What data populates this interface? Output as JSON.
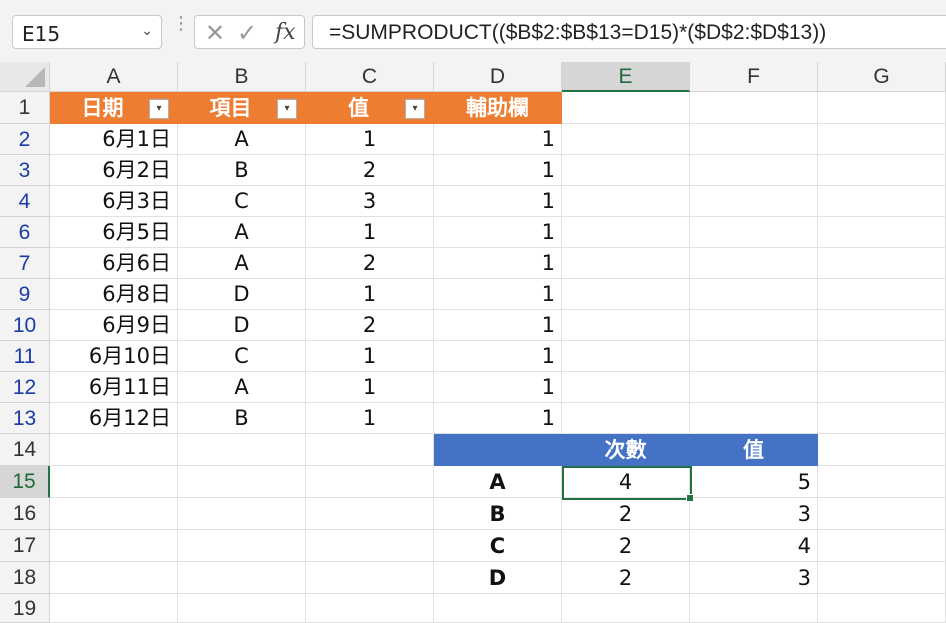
{
  "name_box": "E15",
  "formula": "=SUMPRODUCT(($B$2:$B$13=D15)*($D$2:$D$13))",
  "columns": [
    "A",
    "B",
    "C",
    "D",
    "E",
    "F",
    "G"
  ],
  "rows": [
    "1",
    "2",
    "3",
    "4",
    "6",
    "7",
    "9",
    "10",
    "11",
    "12",
    "13",
    "14",
    "15",
    "16",
    "17",
    "18",
    "19"
  ],
  "header": {
    "a": "日期",
    "b": "項目",
    "c": "值",
    "d": "輔助欄"
  },
  "data": [
    {
      "a": "6月1日",
      "b": "A",
      "c": "1",
      "d": "1"
    },
    {
      "a": "6月2日",
      "b": "B",
      "c": "2",
      "d": "1"
    },
    {
      "a": "6月3日",
      "b": "C",
      "c": "3",
      "d": "1"
    },
    {
      "a": "6月5日",
      "b": "A",
      "c": "1",
      "d": "1"
    },
    {
      "a": "6月6日",
      "b": "A",
      "c": "2",
      "d": "1"
    },
    {
      "a": "6月8日",
      "b": "D",
      "c": "1",
      "d": "1"
    },
    {
      "a": "6月9日",
      "b": "D",
      "c": "2",
      "d": "1"
    },
    {
      "a": "6月10日",
      "b": "C",
      "c": "1",
      "d": "1"
    },
    {
      "a": "6月11日",
      "b": "A",
      "c": "1",
      "d": "1"
    },
    {
      "a": "6月12日",
      "b": "B",
      "c": "1",
      "d": "1"
    }
  ],
  "summary_header": {
    "e": "次數",
    "f": "值"
  },
  "summary": [
    {
      "d": "A",
      "e": "4",
      "f": "5"
    },
    {
      "d": "B",
      "e": "2",
      "f": "3"
    },
    {
      "d": "C",
      "e": "2",
      "f": "4"
    },
    {
      "d": "D",
      "e": "2",
      "f": "3"
    }
  ]
}
